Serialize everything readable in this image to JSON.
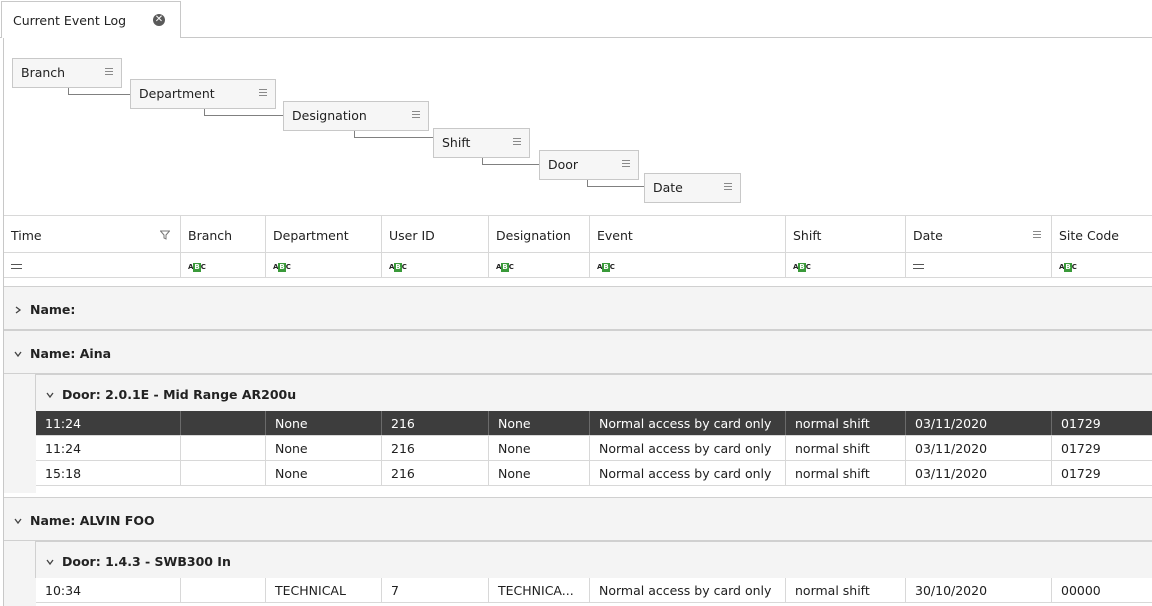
{
  "tab": {
    "title": "Current Event Log",
    "close_glyph": "✕"
  },
  "group_panel": {
    "items": [
      {
        "label": "Branch"
      },
      {
        "label": "Department"
      },
      {
        "label": "Designation"
      },
      {
        "label": "Shift"
      },
      {
        "label": "Door"
      },
      {
        "label": "Date"
      }
    ]
  },
  "columns": [
    {
      "key": "time",
      "label": "Time",
      "filter": "eq"
    },
    {
      "key": "branch",
      "label": "Branch",
      "filter": "abc"
    },
    {
      "key": "department",
      "label": "Department",
      "filter": "abc"
    },
    {
      "key": "user_id",
      "label": "User ID",
      "filter": "abc"
    },
    {
      "key": "designation",
      "label": "Designation",
      "filter": "abc"
    },
    {
      "key": "event",
      "label": "Event",
      "filter": "abc"
    },
    {
      "key": "shift",
      "label": "Shift",
      "filter": "abc"
    },
    {
      "key": "date",
      "label": "Date",
      "filter": "eq"
    },
    {
      "key": "site_code",
      "label": "Site Code",
      "filter": "abc"
    }
  ],
  "filter_icon_text": "ABC",
  "groups": [
    {
      "label": "Name:",
      "expanded": false,
      "chevron": "›"
    },
    {
      "label": "Name: Aina",
      "expanded": true,
      "chevron": "⌄",
      "subgroup": {
        "label": "Door: 2.0.1E - Mid Range AR200u",
        "chevron": "⌄"
      },
      "rows": [
        {
          "time": "11:24",
          "branch": "",
          "department": "None",
          "user_id": "216",
          "designation": "None",
          "event": "Normal access by card only",
          "shift": "normal shift",
          "date": "03/11/2020",
          "site_code": "01729",
          "selected": true
        },
        {
          "time": "11:24",
          "branch": "",
          "department": "None",
          "user_id": "216",
          "designation": "None",
          "event": "Normal access by card only",
          "shift": "normal shift",
          "date": "03/11/2020",
          "site_code": "01729",
          "selected": false
        },
        {
          "time": "15:18",
          "branch": "",
          "department": "None",
          "user_id": "216",
          "designation": "None",
          "event": "Normal access by card only",
          "shift": "normal shift",
          "date": "03/11/2020",
          "site_code": "01729",
          "selected": false
        }
      ]
    },
    {
      "label": "Name: ALVIN FOO",
      "expanded": true,
      "chevron": "⌄",
      "subgroup": {
        "label": "Door: 1.4.3 - SWB300 In",
        "chevron": "⌄"
      },
      "rows": [
        {
          "time": "10:34",
          "branch": "",
          "department": "TECHNICAL",
          "user_id": "7",
          "designation": "TECHNICA...",
          "event": "Normal access by card only",
          "shift": "normal shift",
          "date": "30/10/2020",
          "site_code": "00000",
          "selected": false
        }
      ]
    }
  ],
  "colors": {
    "selected_row": "#3d3d3d",
    "group_bg": "#f4f4f4",
    "filter_badge": "#3a9a3a"
  }
}
